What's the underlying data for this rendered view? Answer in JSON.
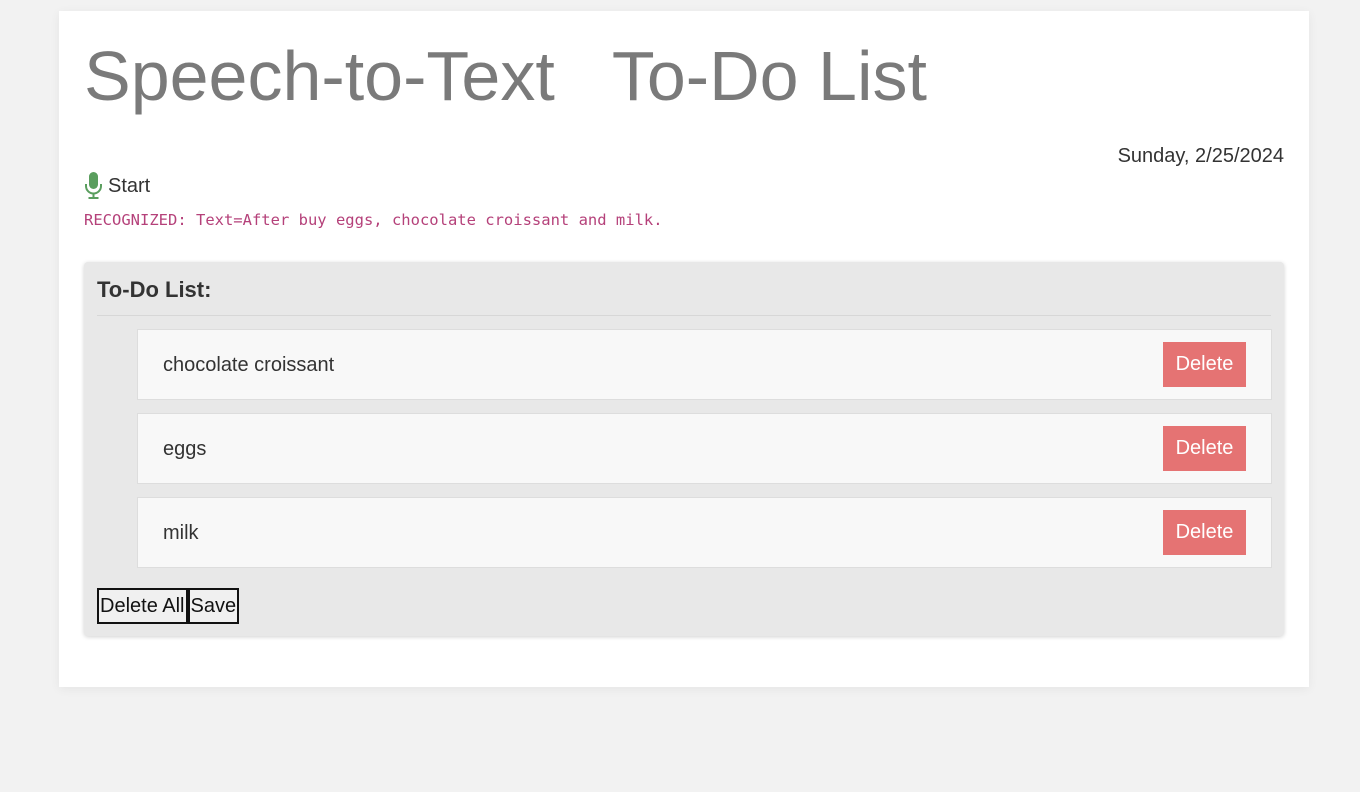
{
  "header": {
    "title": "Speech-to-Text   To-Do List",
    "date": "Sunday, 2/25/2024"
  },
  "speech": {
    "start_label": "Start",
    "mic_icon": "microphone-icon",
    "mic_color": "#5a9e5e",
    "recognized_text": "RECOGNIZED: Text=After buy eggs, chocolate croissant and milk.",
    "recognized_color": "#b5417a"
  },
  "todo": {
    "heading": "To-Do List:",
    "items": [
      {
        "text": "chocolate croissant",
        "delete_label": "Delete"
      },
      {
        "text": "eggs",
        "delete_label": "Delete"
      },
      {
        "text": "milk",
        "delete_label": "Delete"
      }
    ],
    "delete_all_label": "Delete All",
    "save_label": "Save",
    "delete_color": "#e57373"
  }
}
